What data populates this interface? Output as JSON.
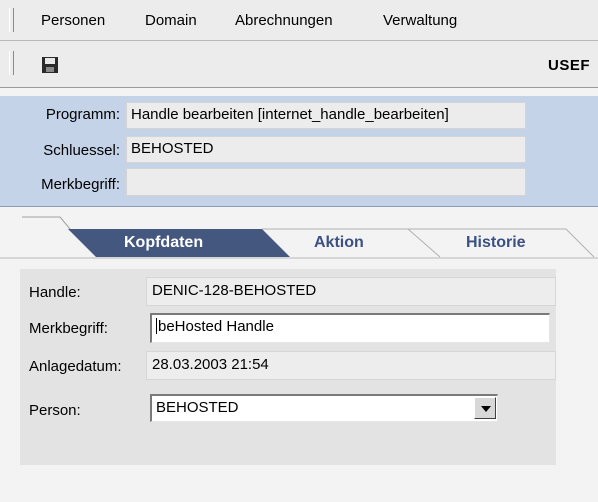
{
  "menu": {
    "items": [
      "Personen",
      "Domain",
      "Abrechnungen",
      "Verwaltung"
    ]
  },
  "toolbar": {
    "save_icon": "save-icon",
    "user_label": "USEF"
  },
  "header": {
    "programm_label": "Programm:",
    "programm_value": "Handle bearbeiten [internet_handle_bearbeiten]",
    "schluessel_label": "Schluessel:",
    "schluessel_value": "BEHOSTED",
    "merkbegriff_label": "Merkbegriff:",
    "merkbegriff_value": ""
  },
  "tabs": [
    {
      "label": "Kopfdaten",
      "active": true
    },
    {
      "label": "Aktion",
      "active": false
    },
    {
      "label": "Historie",
      "active": false
    }
  ],
  "form": {
    "handle_label": "Handle:",
    "handle_value": "DENIC-128-BEHOSTED",
    "merkbegriff_label": "Merkbegriff:",
    "merkbegriff_value": "beHosted Handle",
    "anlagedatum_label": "Anlagedatum:",
    "anlagedatum_value": "28.03.2003 21:54",
    "person_label": "Person:",
    "person_value": "BEHOSTED"
  },
  "colors": {
    "header_bg": "#c5d3e8",
    "tab_active": "#44577f",
    "tab_text": "#3b5182"
  }
}
